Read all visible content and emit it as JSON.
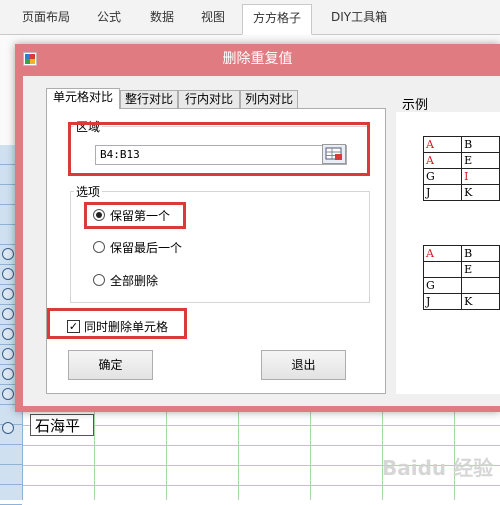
{
  "ribbon": {
    "tabs": [
      "页面布局",
      "公式",
      "数据",
      "视图",
      "方方格子",
      "DIY工具箱"
    ],
    "active_tab": "方方格子"
  },
  "sheet": {
    "cell_text": "石海平"
  },
  "dialog": {
    "title": "删除重复值",
    "tabs": [
      "单元格对比",
      "整行对比",
      "行内对比",
      "列内对比"
    ],
    "area_label": "区域",
    "range_value": "B4:B13",
    "options_label": "选项",
    "radio_options": [
      "保留第一个",
      "保留最后一个",
      "全部删除"
    ],
    "selected_option": "保留第一个",
    "checkbox_label": "同时删除单元格",
    "checkbox_checked": true,
    "ok_button": "确定",
    "exit_button": "退出",
    "preview_label": "示例",
    "preview_before": [
      [
        "A",
        "B"
      ],
      [
        "A",
        "E"
      ],
      [
        "G",
        "I"
      ],
      [
        "J",
        "K"
      ]
    ],
    "preview_after": [
      [
        "A",
        "B"
      ],
      [
        "",
        "E"
      ],
      [
        "G",
        ""
      ],
      [
        "J",
        "K"
      ]
    ],
    "highlight_color": "#d01f1f",
    "title_bar_color": "#e07b82",
    "annotation_color": "#d93b3b"
  },
  "icons": [
    "app-icon",
    "range-picker-icon",
    "circle-button-icon",
    "check-icon"
  ]
}
